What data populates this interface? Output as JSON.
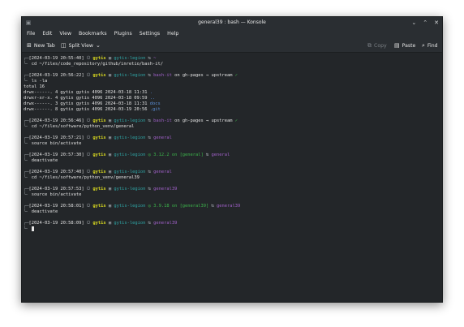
{
  "window": {
    "title": "general39 : bash — Konsole"
  },
  "menu": [
    "File",
    "Edit",
    "View",
    "Bookmarks",
    "Plugins",
    "Settings",
    "Help"
  ],
  "toolbar": {
    "new_tab": "New Tab",
    "split_view": "Split View",
    "copy": "Copy",
    "paste": "Paste",
    "find": "Find"
  },
  "terminal": {
    "blocks": [
      {
        "time": "[2024-03-19 20:55:40]",
        "user": "gytis",
        "host": "gytis-legion",
        "dir": "~",
        "cmd": "cd ~/files/code_repository/github/inretio/bash-it/"
      },
      {
        "time": "[2024-03-19 20:56:22]",
        "user": "gytis",
        "host": "gytis-legion",
        "dir": "bash-it",
        "git": "on gh-pages → upstream",
        "check": "✓",
        "cmd": "ls -la",
        "output": [
          {
            "text": "total 16"
          },
          {
            "text": "drwx------. 4 gytis gytis 4096 2024-03-18 11:31 ",
            "name": "."
          },
          {
            "text": "drwxr-xr-x. 4 gytis gytis 4096 2024-03-18 09:59 ",
            "name": ".."
          },
          {
            "text": "drwx------. 3 gytis gytis 4096 2024-03-18 11:31 ",
            "name": "docs"
          },
          {
            "text": "drwx------. 8 gytis gytis 4096 2024-03-19 20:56 ",
            "name": ".git"
          }
        ]
      },
      {
        "time": "[2024-03-19 20:56:46]",
        "user": "gytis",
        "host": "gytis-legion",
        "dir": "bash-it",
        "git": "on gh-pages → upstream",
        "check": "✓",
        "cmd": "cd ~/files/software/python_venv/general"
      },
      {
        "time": "[2024-03-19 20:57:21]",
        "user": "gytis",
        "host": "gytis-legion",
        "dir": "general",
        "cmd": "source bin/activate"
      },
      {
        "time": "[2024-03-19 20:57:30]",
        "user": "gytis",
        "host": "gytis-legion",
        "py": "3.12.2 on [general]",
        "dir": "general",
        "cmd": "deactivate"
      },
      {
        "time": "[2024-03-19 20:57:40]",
        "user": "gytis",
        "host": "gytis-legion",
        "dir": "general",
        "cmd": "cd ~/files/software/python_venv/general39"
      },
      {
        "time": "[2024-03-19 20:57:53]",
        "user": "gytis",
        "host": "gytis-legion",
        "dir": "general39",
        "cmd": "source bin/activate"
      },
      {
        "time": "[2024-03-19 20:58:01]",
        "user": "gytis",
        "host": "gytis-legion",
        "py": "3.9.18 on [general39]",
        "dir": "general39",
        "cmd": "deactivate"
      },
      {
        "time": "[2024-03-19 20:58:09]",
        "user": "gytis",
        "host": "gytis-legion",
        "dir": "general39",
        "cmd": ""
      }
    ]
  }
}
